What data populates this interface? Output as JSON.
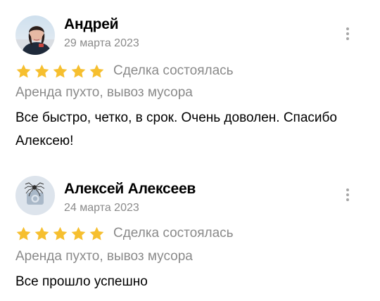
{
  "colors": {
    "star": "#F6BF2F",
    "muted_text": "#8A8A8A",
    "text": "#000000",
    "background": "#FFFFFF"
  },
  "reviews": [
    {
      "author": "Андрей",
      "date": "29 марта 2023",
      "rating": 5,
      "deal_status": "Сделка состоялась",
      "service": "Аренда пухто, вывоз мусора",
      "text": "Все быстро, четко, в срок. Очень доволен. Спасибо Алексею!",
      "avatar": "user-photo",
      "menu_icon": "more-vertical-icon"
    },
    {
      "author": "Алексей Алексеев",
      "date": "24 марта 2023",
      "rating": 5,
      "deal_status": "Сделка состоялась",
      "service": "Аренда пухто, вывоз мусора",
      "text": "Все прошло успешно",
      "avatar": "camera-placeholder",
      "menu_icon": "more-vertical-icon"
    }
  ]
}
